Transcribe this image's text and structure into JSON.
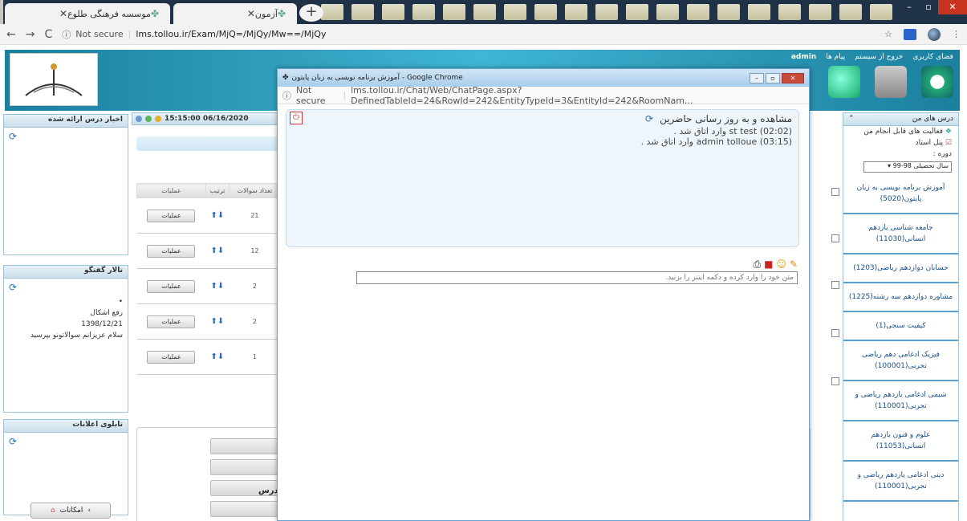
{
  "browser": {
    "tabs": [
      {
        "title": "موسسه فرهنگی طلوع"
      },
      {
        "title": "آزمون"
      }
    ],
    "url_security": "Not secure",
    "url": "lms.tollou.ir/Exam/MjQ=/MjQy/Mw==/MjQy"
  },
  "header": {
    "admin_label": "admin",
    "links": [
      "فضای کاربری",
      "خروج از سیستم",
      "پیام ها"
    ]
  },
  "left": {
    "panel1_title": "اخبار درس ارائه شده",
    "panel2_title": "تالار گفتگو",
    "forum_bullet": "•",
    "forum_subject": "رفع اشکال",
    "forum_date": "1398/12/21",
    "forum_text": "سلام عزیزانم سوالاتونو بپرسید",
    "panel3_title": "تابلوی اعلانات",
    "facility_label": "امکانات"
  },
  "main": {
    "datetime": "15:15:00 06/16/2020",
    "columns": [
      "عملیات",
      "ترتیب",
      "تعداد سوالات"
    ],
    "rows": [
      {
        "op": "عملیات",
        "count": "21"
      },
      {
        "op": "عملیات",
        "count": "12"
      },
      {
        "op": "عملیات",
        "count": "2"
      },
      {
        "op": "عملیات",
        "count": "2"
      },
      {
        "op": "عملیات",
        "count": "1"
      }
    ],
    "dars_label": "درس"
  },
  "right": {
    "my_courses": "درس های من",
    "activities": "فعالیت های قابل انجام من",
    "teacher_panel": "پنل استاد",
    "period_label": "دوره :",
    "period_value": "سال تحصیلی 98-99",
    "courses": [
      "آموزش برنامه نویسی به زبان پایتون(5020)",
      "جامعه شناسی یازدهم انسانی(11030)",
      "حسابان دوازدهم ریاضی(1203)",
      "مشاوره دوازدهم سه رشته(1225)",
      "کیفیت سنجی(1)",
      "فیزیک ادغامی دهم ریاضی تجربی(100001)",
      "شیمی ادغامی یازدهم ریاضی و تجربی(110001)",
      "علوم و فنون یازدهم انسانی(11053)",
      "دینی ادغامی یازدهم ریاضی و تجربی(110001)"
    ]
  },
  "popup": {
    "title": "آموزش برنامه نویسی به زبان پایتون - Google Chrome",
    "url_security": "Not secure",
    "url": "lms.tollou.ir/Chat/Web/ChatPage.aspx?DefinedTableId=24&RowId=242&EntityTypeId=3&EntityId=242&RoomNam...",
    "chat_title": "مشاهده و به روز رسانی حاضرین",
    "messages": [
      "st test (02:02) وارد اتاق شد .",
      "admin tolloue (03:15) وارد اتاق شد ."
    ],
    "input_placeholder": "متن خود را وارد کرده و دکمه اینتر را بزنید."
  }
}
